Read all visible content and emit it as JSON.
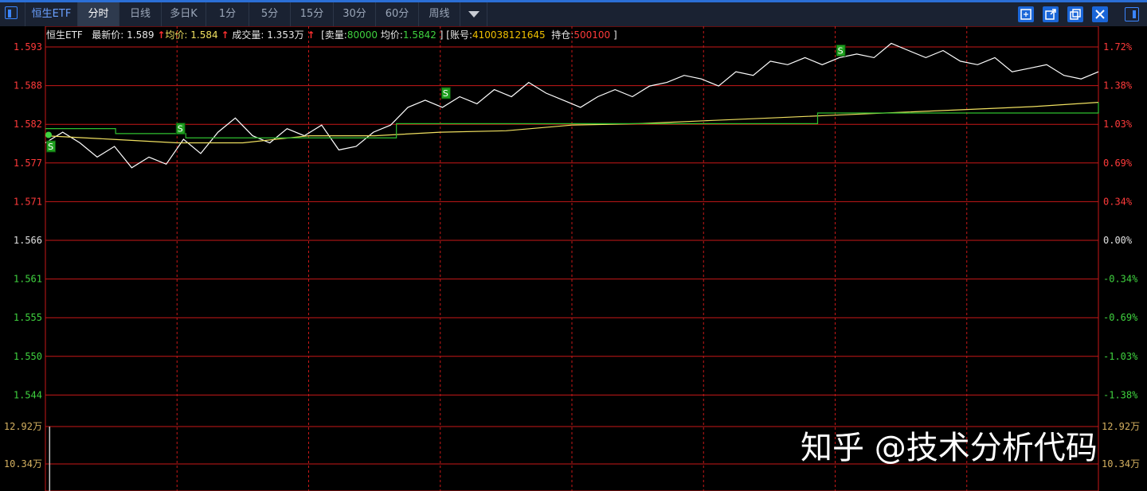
{
  "toolbar": {
    "symbol": "恒生ETF",
    "tabs": [
      {
        "label": "分时",
        "active": true
      },
      {
        "label": "日线",
        "active": false
      },
      {
        "label": "多日K",
        "active": false
      },
      {
        "label": "1分",
        "active": false
      },
      {
        "label": "5分",
        "active": false
      },
      {
        "label": "15分",
        "active": false
      },
      {
        "label": "30分",
        "active": false
      },
      {
        "label": "60分",
        "active": false
      },
      {
        "label": "周线",
        "active": false
      }
    ],
    "icons": [
      "panel-left-icon",
      "chevron-down-icon",
      "fit-icon",
      "popout-icon",
      "window-icon",
      "close-icon",
      "panel-right-icon"
    ]
  },
  "info": {
    "name": "恒生ETF",
    "latest_label": "最新价:",
    "latest_value": "1.589",
    "avg_label": "均价:",
    "avg_value": "1.584",
    "volume_label": "成交量:",
    "volume_value": "1.353万",
    "sell_label": "[卖量:",
    "sell_value": "80000",
    "sell_avg_label": "均价:",
    "sell_avg_value": "1.5842",
    "bracket_close": "]",
    "account_label": "[账号:",
    "account_value": "410038121645",
    "position_label": "持仓:",
    "position_value": "500100",
    "bracket_close2": "]"
  },
  "colors": {
    "up": "#ff3a3a",
    "down": "#3fd23f",
    "grid": "#c81818",
    "price_line": "#ffffff",
    "avg_line": "#f0e060",
    "cost_line": "#2fbf2f",
    "accent": "#2b6fd6"
  },
  "watermark": "知乎 @技术分析代码",
  "chart_data": {
    "type": "line",
    "title": "",
    "base_price": 1.566,
    "ylim": [
      1.5395,
      1.5945
    ],
    "left_ticks": [
      "1.593",
      "1.588",
      "1.582",
      "1.577",
      "1.571",
      "1.566",
      "1.561",
      "1.555",
      "1.550",
      "1.544"
    ],
    "right_ticks": [
      "1.72%",
      "1.38%",
      "1.03%",
      "0.69%",
      "0.34%",
      "0.00%",
      "-0.34%",
      "-0.69%",
      "-1.03%",
      "-1.38%"
    ],
    "volume_ticks": [
      "12.92万",
      "10.34万"
    ],
    "series": [
      {
        "name": "",
        "role": "price",
        "values": [
          1.5795,
          1.581,
          1.5795,
          1.5775,
          1.579,
          1.576,
          1.5775,
          1.5765,
          1.58,
          1.578,
          1.581,
          1.583,
          1.5805,
          1.5795,
          1.5815,
          1.5805,
          1.582,
          1.5785,
          1.579,
          1.581,
          1.582,
          1.5845,
          1.5855,
          1.5845,
          1.586,
          1.585,
          1.587,
          1.586,
          1.588,
          1.5865,
          1.5855,
          1.5845,
          1.586,
          1.587,
          1.586,
          1.5875,
          1.588,
          1.589,
          1.5885,
          1.5875,
          1.5895,
          1.589,
          1.591,
          1.5905,
          1.5915,
          1.5905,
          1.5915,
          1.592,
          1.5915,
          1.5935,
          1.5925,
          1.5915,
          1.5925,
          1.591,
          1.5905,
          1.5915,
          1.5895,
          1.59,
          1.5905,
          1.589,
          1.5885,
          1.5895
        ]
      },
      {
        "name": "",
        "role": "average",
        "values": [
          1.5805,
          1.58,
          1.5795,
          1.5795,
          1.5805,
          1.5805,
          1.581,
          1.5812,
          1.582,
          1.5822,
          1.5826,
          1.583,
          1.5834,
          1.5838,
          1.5842,
          1.5846,
          1.5852
        ]
      },
      {
        "name": "",
        "role": "cost",
        "values": [
          1.5815,
          1.5808,
          1.5802,
          1.5802,
          1.5802,
          1.5822,
          1.5822,
          1.5822,
          1.5822,
          1.5822,
          1.5822,
          1.5837,
          1.5837,
          1.5837,
          1.5837,
          1.5852
        ]
      }
    ],
    "markers": [
      {
        "label": "S",
        "at": 0.005,
        "price": 1.579
      },
      {
        "label": "S",
        "at": 0.128,
        "price": 1.5815
      },
      {
        "label": "S",
        "at": 0.38,
        "price": 1.5865
      },
      {
        "label": "S",
        "at": 0.755,
        "price": 1.5925
      }
    ],
    "volume": [
      {
        "at": 0.004,
        "value": 12.92
      }
    ]
  }
}
